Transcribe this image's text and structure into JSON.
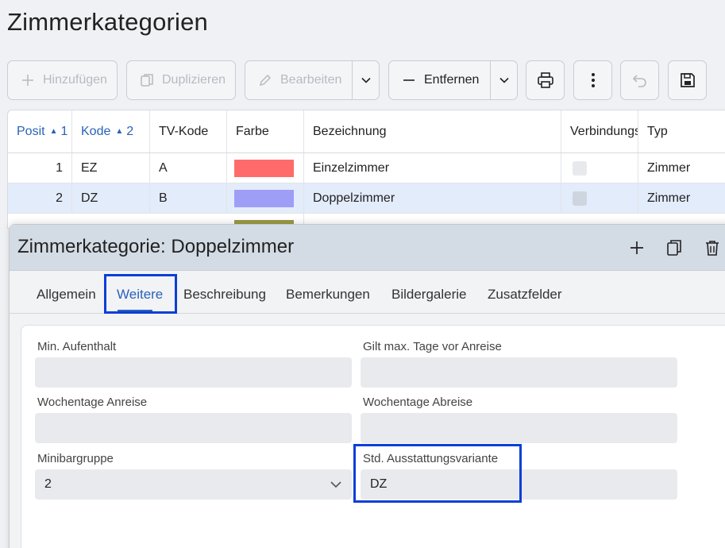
{
  "page": {
    "title": "Zimmerkategorien"
  },
  "toolbar": {
    "add_label": "Hinzufügen",
    "duplicate_label": "Duplizieren",
    "edit_label": "Bearbeiten",
    "remove_label": "Entfernen"
  },
  "grid": {
    "columns": [
      {
        "label": "Posit",
        "sort": "1"
      },
      {
        "label": "Kode",
        "sort": "2"
      },
      {
        "label": "TV-Kode"
      },
      {
        "label": "Farbe"
      },
      {
        "label": "Bezeichnung"
      },
      {
        "label": "Verbindungs"
      },
      {
        "label": "Typ"
      }
    ],
    "rows": [
      {
        "pos": "1",
        "kode": "EZ",
        "tv": "A",
        "color": "#ff6b6b",
        "name": "Einzelzimmer",
        "typ": "Zimmer"
      },
      {
        "pos": "2",
        "kode": "DZ",
        "tv": "B",
        "color": "#9e9ef7",
        "name": "Doppelzimmer",
        "typ": "Zimmer"
      },
      {
        "color": "#9a9a45"
      }
    ]
  },
  "dialog": {
    "title": "Zimmerkategorie: Doppelzimmer",
    "tabs": [
      "Allgemein",
      "Weitere",
      "Beschreibung",
      "Bemerkungen",
      "Bildergalerie",
      "Zusatzfelder"
    ],
    "active_tab": "Weitere",
    "form": {
      "min_stay_label": "Min. Aufenthalt",
      "min_stay_value": "",
      "max_days_label": "Gilt max. Tage vor Anreise",
      "max_days_value": "",
      "arrival_days_label": "Wochentage Anreise",
      "arrival_days_value": "",
      "departure_days_label": "Wochentage Abreise",
      "departure_days_value": "",
      "minibar_label": "Minibargruppe",
      "minibar_value": "2",
      "equipment_label": "Std. Ausstattungsvariante",
      "equipment_value": "DZ"
    }
  },
  "colors": {
    "accent": "#2a62b8",
    "highlight": "#0b3fd6",
    "selected_row": "#e3ecfa"
  },
  "icons": [
    "plus-icon",
    "duplicate-icon",
    "pencil-icon",
    "chevron-down-icon",
    "minus-icon",
    "printer-icon",
    "more-vertical-icon",
    "undo-icon",
    "save-icon",
    "trash-icon"
  ]
}
